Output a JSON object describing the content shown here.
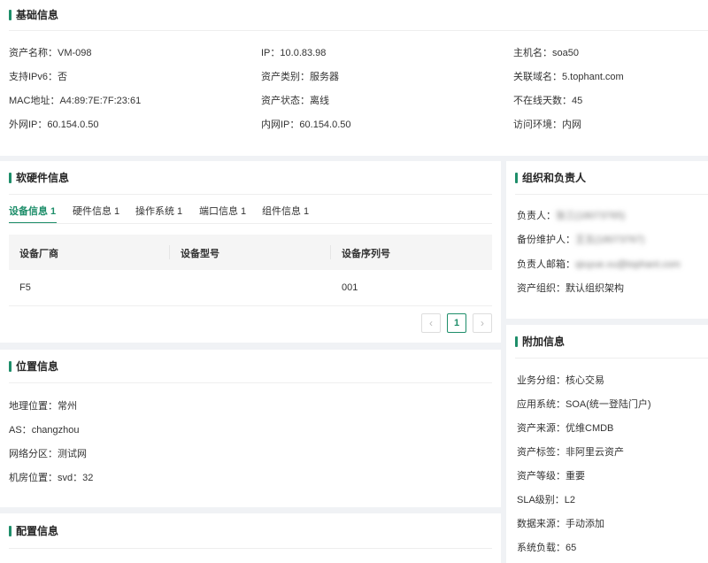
{
  "basic": {
    "title": "基础信息",
    "fields": [
      {
        "label": "资产名称：",
        "value": "VM-098"
      },
      {
        "label": "IP：",
        "value": "10.0.83.98"
      },
      {
        "label": "主机名：",
        "value": "soa50"
      },
      {
        "label": "支持IPv6：",
        "value": "否"
      },
      {
        "label": "资产类别：",
        "value": "服务器"
      },
      {
        "label": "关联域名：",
        "value": "5.tophant.com"
      },
      {
        "label": "MAC地址：",
        "value": "A4:89:7E:7F:23:61"
      },
      {
        "label": "资产状态：",
        "value": "离线"
      },
      {
        "label": "不在线天数：",
        "value": "45"
      },
      {
        "label": "外网IP：",
        "value": "60.154.0.50"
      },
      {
        "label": "内网IP：",
        "value": "60.154.0.50"
      },
      {
        "label": "访问环境：",
        "value": "内网"
      }
    ]
  },
  "software": {
    "title": "软硬件信息",
    "tabs": [
      "设备信息 1",
      "硬件信息 1",
      "操作系统 1",
      "端口信息 1",
      "组件信息 1"
    ],
    "active_tab": 0,
    "columns": [
      "设备厂商",
      "设备型号",
      "设备序列号"
    ],
    "rows": [
      [
        "F5",
        "",
        "001"
      ]
    ],
    "pagination": {
      "prev": "‹",
      "current": "1",
      "next": "›"
    }
  },
  "org": {
    "title": "组织和负责人",
    "fields": [
      {
        "label": "负责人：",
        "value": "张三(18073765)"
      },
      {
        "label": "备份维护人：",
        "value": "王五(18073767)"
      },
      {
        "label": "负责人邮箱：",
        "value": "qiuyue.xu@tophant.com"
      },
      {
        "label": "资产组织：",
        "value": "默认组织架构"
      }
    ]
  },
  "location": {
    "title": "位置信息",
    "fields": [
      {
        "label": "地理位置：",
        "value": "常州"
      },
      {
        "label": "AS：",
        "value": "changzhou"
      },
      {
        "label": "网络分区：",
        "value": "测试网"
      },
      {
        "label": "机房位置：",
        "value": "svd：32"
      }
    ]
  },
  "extra": {
    "title": "附加信息",
    "fields": [
      {
        "label": "业务分组：",
        "value": "核心交易"
      },
      {
        "label": "应用系统：",
        "value": "SOA(统一登陆门户)"
      },
      {
        "label": "资产来源：",
        "value": "优维CMDB"
      },
      {
        "label": "资产标签：",
        "value": "非阿里云资产"
      },
      {
        "label": "资产等级：",
        "value": "重要"
      },
      {
        "label": "SLA级别：",
        "value": "L2"
      },
      {
        "label": "数据来源：",
        "value": "手动添加"
      },
      {
        "label": "系统负载：",
        "value": "65"
      }
    ]
  },
  "config": {
    "title": "配置信息"
  },
  "colors": {
    "accent": "#1e8e6a",
    "background": "#f0f2f5"
  }
}
